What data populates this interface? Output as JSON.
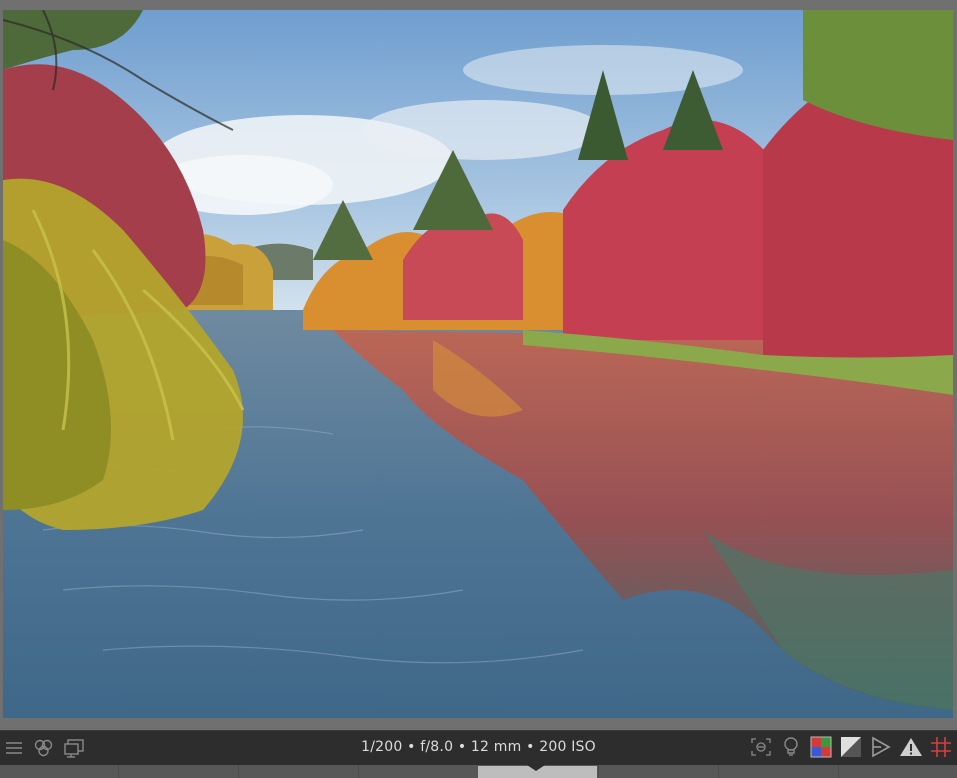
{
  "photo": {
    "exif_text": "1/200 • f/8.0 • 12 mm • 200 ISO"
  },
  "toolbar_left": [
    {
      "name": "menu-icon"
    },
    {
      "name": "color-balance-icon"
    },
    {
      "name": "display-icon"
    }
  ],
  "toolbar_right": [
    {
      "name": "focus-peaking-icon"
    },
    {
      "name": "lightbulb-icon"
    },
    {
      "name": "color-assessment-icon"
    },
    {
      "name": "exposure-contrast-icon"
    },
    {
      "name": "gamut-icon"
    },
    {
      "name": "warning-icon"
    },
    {
      "name": "grid-icon"
    }
  ],
  "colors": {
    "toolbar_bg": "#2d2d2d",
    "viewer_bg": "#707070",
    "grid_accent": "#d44040"
  }
}
